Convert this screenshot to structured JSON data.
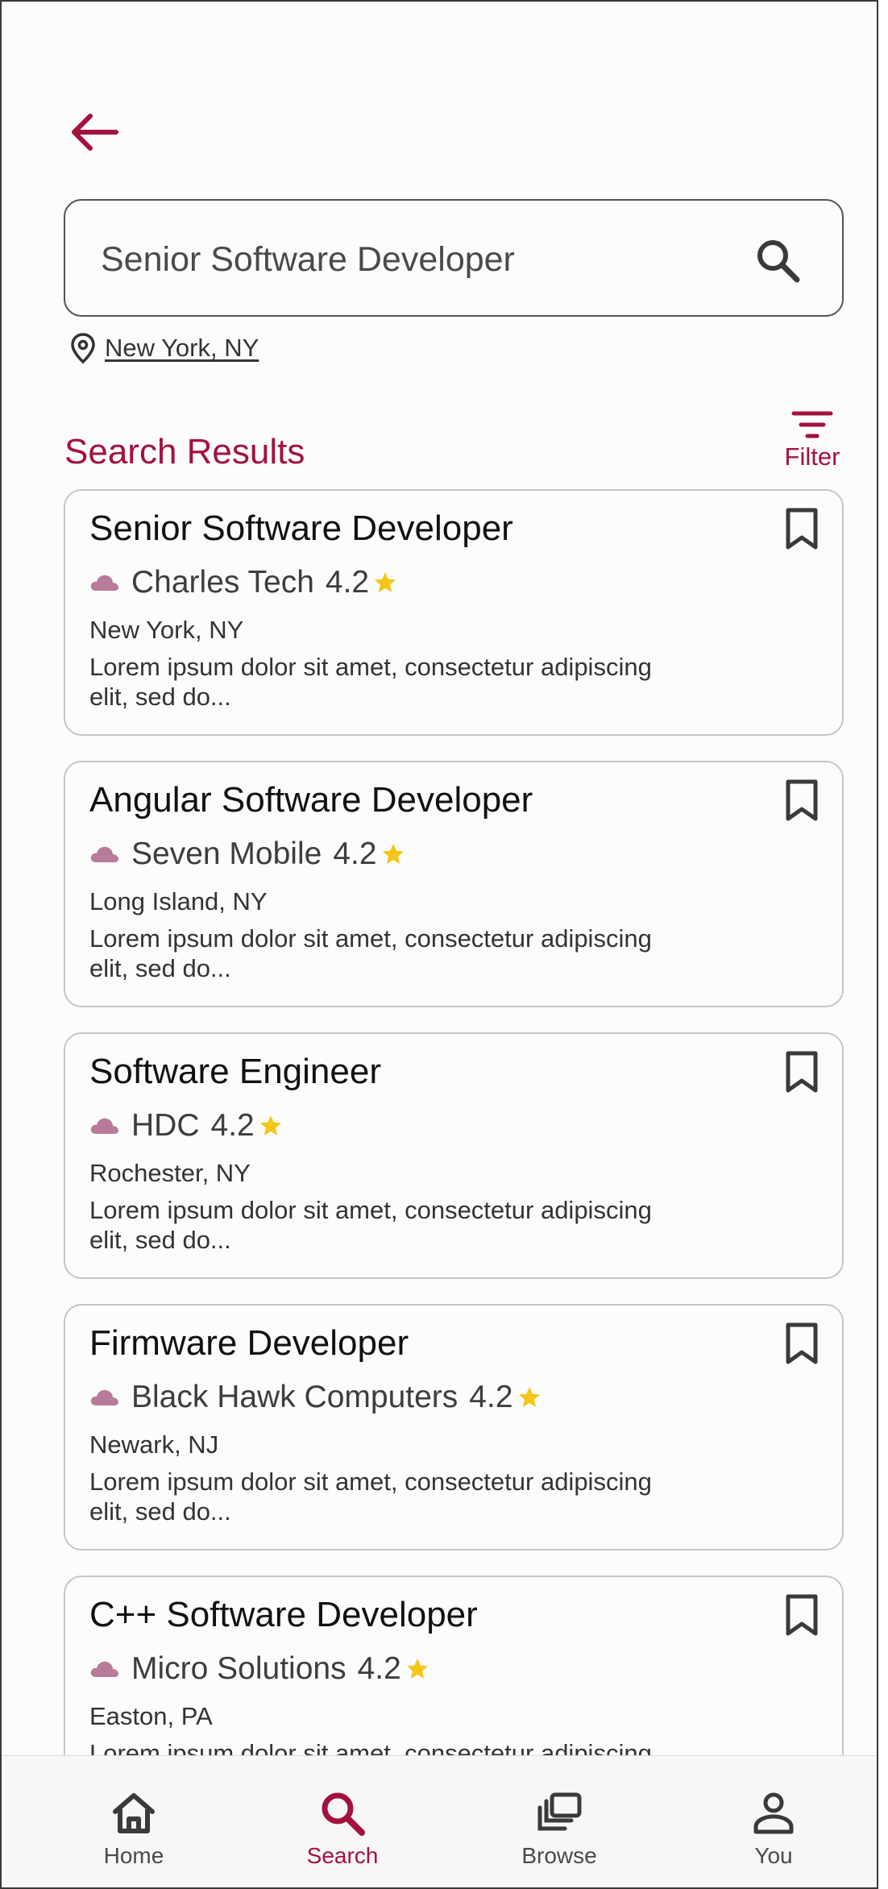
{
  "colors": {
    "accent": "#a3123d",
    "star": "#f5c518",
    "cloud": "#b97b9b"
  },
  "search": {
    "query": "Senior Software Developer",
    "location": "New York, NY"
  },
  "results": {
    "title": "Search Results",
    "filter_label": "Filter",
    "jobs": [
      {
        "title": "Senior Software Developer",
        "company": "Charles Tech",
        "rating": "4.2",
        "location": "New York, NY",
        "description": "Lorem ipsum dolor sit amet, consectetur adipiscing elit, sed do..."
      },
      {
        "title": "Angular Software Developer",
        "company": "Seven Mobile",
        "rating": "4.2",
        "location": "Long Island, NY",
        "description": "Lorem ipsum dolor sit amet, consectetur adipiscing elit, sed do..."
      },
      {
        "title": "Software Engineer",
        "company": "HDC",
        "rating": "4.2",
        "location": "Rochester, NY",
        "description": "Lorem ipsum dolor sit amet, consectetur adipiscing elit, sed do..."
      },
      {
        "title": "Firmware Developer",
        "company": "Black Hawk Computers",
        "rating": "4.2",
        "location": "Newark, NJ",
        "description": "Lorem ipsum dolor sit amet, consectetur adipiscing elit, sed do..."
      },
      {
        "title": "C++ Software Developer",
        "company": "Micro Solutions",
        "rating": "4.2",
        "location": "Easton, PA",
        "description": "Lorem ipsum dolor sit amet, consectetur adipiscing elit, sed do..."
      }
    ]
  },
  "nav": {
    "items": [
      {
        "label": "Home",
        "icon": "home-icon"
      },
      {
        "label": "Search",
        "icon": "search-icon",
        "active": true
      },
      {
        "label": "Browse",
        "icon": "browse-icon"
      },
      {
        "label": "You",
        "icon": "person-icon"
      }
    ]
  }
}
